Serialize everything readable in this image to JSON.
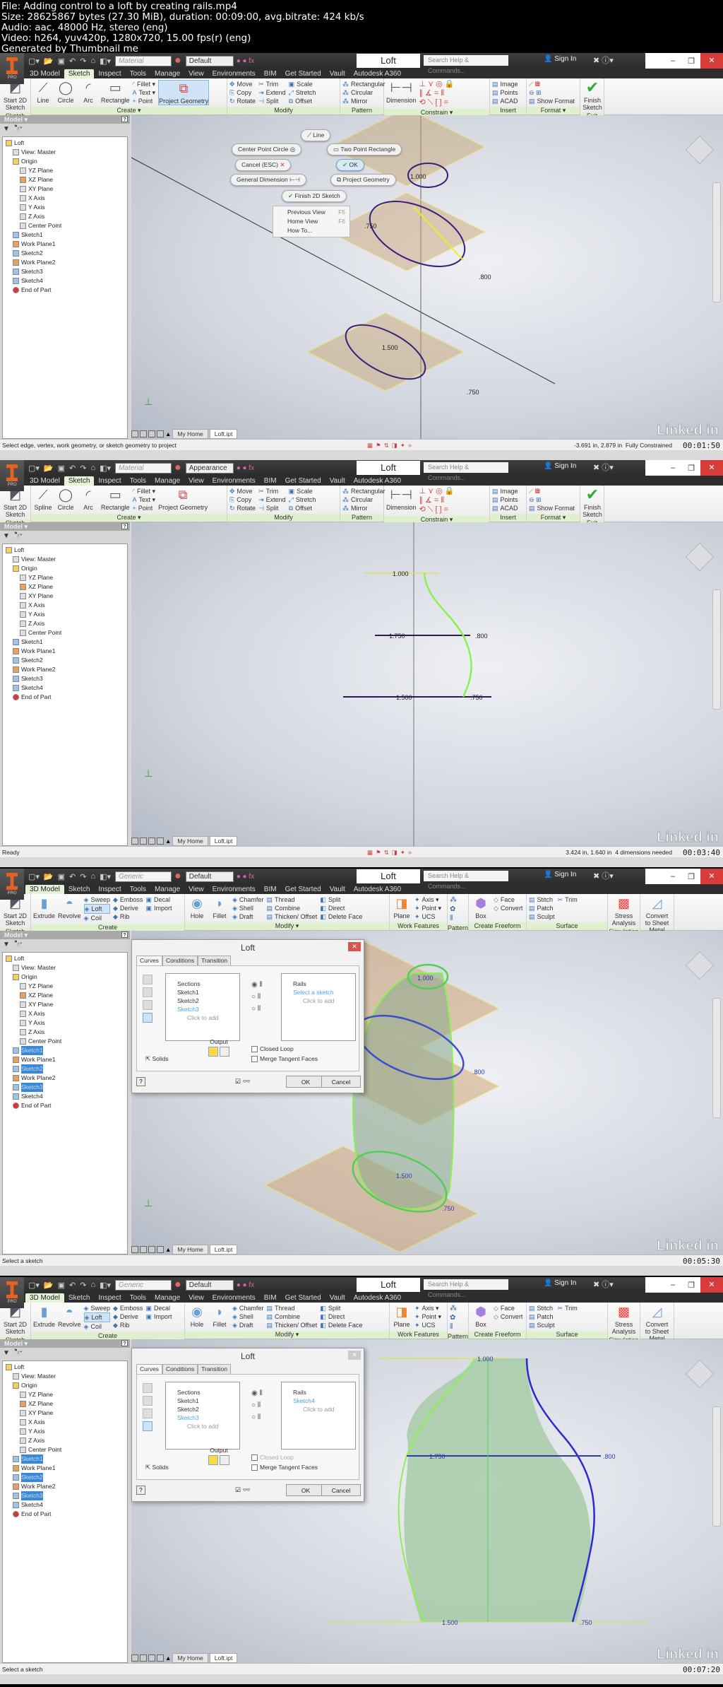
{
  "header": {
    "file": "File: Adding control to a loft by creating rails.mp4",
    "size": "Size: 28625867 bytes (27.30 MiB), duration: 00:09:00, avg.bitrate: 424 kb/s",
    "audio": "Audio: aac, 48000 Hz, stereo (eng)",
    "video": "Video: h264, yuv420p, 1280x720, 15.00 fps(r) (eng)",
    "generator": "Generated by Thumbnail me"
  },
  "common": {
    "doc_title": "Loft",
    "search_placeholder": "Search Help & Commands...",
    "sign_in": "Sign In",
    "tabs": [
      "3D Model",
      "Sketch",
      "Inspect",
      "Tools",
      "Manage",
      "View",
      "Environments",
      "BIM",
      "Get Started",
      "Vault",
      "Autodesk A360"
    ],
    "browser_title": "Model ▾",
    "doc_tabs": {
      "home": "My Home",
      "file": "Loft.ipt"
    },
    "watermark": "Linked in",
    "win": {
      "min": "–",
      "restore": "❐",
      "close": "✕"
    }
  },
  "sketch_ribbon": {
    "sketch_panel": {
      "label": "Sketch",
      "start": "Start 2D Sketch"
    },
    "create_panel": {
      "label": "Create ▾",
      "circle": "Circle",
      "arc": "Arc",
      "rectangle": "Rectangle",
      "fillet": "Fillet ▾",
      "text": "Text ▾",
      "point": "Point",
      "project": "Project Geometry"
    },
    "modify_panel": {
      "label": "Modify",
      "items": [
        "Move",
        "Trim",
        "Scale",
        "Copy",
        "Extend",
        "Stretch",
        "Rotate",
        "Split",
        "Offset"
      ]
    },
    "pattern_panel": {
      "label": "Pattern",
      "items": [
        "Rectangular",
        "Circular",
        "Mirror"
      ]
    },
    "constrain_panel": {
      "label": "Constrain ▾",
      "dimension": "Dimension"
    },
    "insert_panel": {
      "label": "Insert",
      "items": [
        "Image",
        "Points",
        "ACAD"
      ]
    },
    "format_panel": {
      "label": "Format ▾",
      "show_format": "Show Format"
    },
    "exit_panel": {
      "label": "Exit",
      "finish": "Finish Sketch"
    }
  },
  "model_ribbon": {
    "sketch_panel": {
      "label": "Sketch",
      "start": "Start 2D Sketch"
    },
    "create_panel": {
      "label": "Create",
      "extrude": "Extrude",
      "revolve": "Revolve",
      "col1": [
        "Sweep",
        "Loft",
        "Coil"
      ],
      "col2": [
        "Emboss",
        "Derive",
        "Rib"
      ],
      "col3": [
        "Decal",
        "Import"
      ]
    },
    "modify_panel": {
      "label": "Modify ▾",
      "hole": "Hole",
      "fillet": "Fillet",
      "col1": [
        "Chamfer",
        "Shell",
        "Draft"
      ],
      "col2": [
        "Thread",
        "Combine",
        "Thicken/ Offset"
      ],
      "col3": [
        "Split",
        "Direct",
        "Delete Face"
      ]
    },
    "work_panel": {
      "label": "Work Features",
      "plane": "Plane",
      "items": [
        "Axis ▾",
        "Point ▾",
        "UCS"
      ]
    },
    "pattern_panel": {
      "label": "Pattern"
    },
    "freeform_panel": {
      "label": "Create Freeform",
      "box": "Box",
      "items": [
        "Face",
        "Convert"
      ]
    },
    "surface_panel": {
      "label": "Surface",
      "items": [
        "Stitch",
        "Patch",
        "Sculpt",
        "Trim"
      ]
    },
    "simulation_panel": {
      "label": "Simulation",
      "stress": "Stress Analysis"
    },
    "convert_panel": {
      "label": "Convert",
      "sheet": "Convert to Sheet Metal"
    }
  },
  "tree": {
    "items": [
      {
        "label": "Loft",
        "indent": 0,
        "icon": "part"
      },
      {
        "label": "View: Master",
        "indent": 1,
        "icon": "view"
      },
      {
        "label": "Origin",
        "indent": 1,
        "icon": "folder"
      },
      {
        "label": "YZ Plane",
        "indent": 2,
        "icon": "plane"
      },
      {
        "label": "XZ Plane",
        "indent": 2,
        "icon": "plane-active"
      },
      {
        "label": "XY Plane",
        "indent": 2,
        "icon": "plane"
      },
      {
        "label": "X Axis",
        "indent": 2,
        "icon": "axis"
      },
      {
        "label": "Y Axis",
        "indent": 2,
        "icon": "axis"
      },
      {
        "label": "Z Axis",
        "indent": 2,
        "icon": "axis"
      },
      {
        "label": "Center Point",
        "indent": 2,
        "icon": "point"
      },
      {
        "label": "Sketch1",
        "indent": 1,
        "icon": "sketch"
      },
      {
        "label": "Work Plane1",
        "indent": 1,
        "icon": "workplane"
      },
      {
        "label": "Sketch2",
        "indent": 1,
        "icon": "sketch"
      },
      {
        "label": "Work Plane2",
        "indent": 1,
        "icon": "workplane"
      },
      {
        "label": "Sketch3",
        "indent": 1,
        "icon": "sketch"
      },
      {
        "label": "Sketch4",
        "indent": 1,
        "icon": "sketch"
      },
      {
        "label": "End of Part",
        "indent": 1,
        "icon": "end"
      }
    ]
  },
  "frames": [
    {
      "material": "Material",
      "appearance": "Default",
      "active_tab": "Sketch",
      "ribbon": "sketch",
      "line_tool": "Line",
      "project_highlight": true,
      "status": "Select edge, vertex, work geometry,  or sketch geometry to project",
      "coords": "-3.691 in, 2.879 in",
      "constraint": "Fully Constrained",
      "timestamp": "00:01:50",
      "marking_menu": {
        "line": "Line",
        "circle": "Center Point Circle",
        "rect": "Two Point Rectangle",
        "cancel": "Cancel (ESC)",
        "ok": "OK",
        "dim": "General Dimension",
        "project": "Project Geometry",
        "finish": "Finish 2D Sketch"
      },
      "context_menu": [
        {
          "label": "Previous View",
          "key": "F5"
        },
        {
          "label": "Home View",
          "key": "F6"
        },
        {
          "label": "How To...",
          "key": ""
        }
      ],
      "dims": [
        "1.000",
        ".750",
        ".800",
        "1.500",
        ".750"
      ]
    },
    {
      "material": "Material",
      "appearance": "Appearance",
      "active_tab": "Sketch",
      "ribbon": "sketch",
      "line_tool": "Spline",
      "project_highlight": false,
      "status": "Ready",
      "coords": "3.424 in, 1.640 in",
      "constraint": "4 dimensions needed",
      "timestamp": "00:03:40",
      "dims": [
        "1.000",
        "1.750",
        ".800",
        "1.500",
        ".750"
      ]
    },
    {
      "material": "Generic",
      "appearance": "Default",
      "active_tab": "3D Model",
      "ribbon": "model",
      "status": "Select a sketch",
      "timestamp": "00:05:30",
      "selected_sketches": [
        "Sketch1",
        "Sketch2",
        "Sketch3"
      ],
      "dialog": {
        "title": "Loft",
        "tabs": [
          "Curves",
          "Conditions",
          "Transition"
        ],
        "sections_header": "Sections",
        "sections": [
          "Sketch1",
          "Sketch2",
          "Sketch3"
        ],
        "sections_add": "Click to add",
        "rails_header": "Rails",
        "rails": [
          "Select a sketch"
        ],
        "rails_add": "Click to add",
        "output": "Output",
        "closed_loop": "Closed Loop",
        "merge": "Merge Tangent Faces",
        "solids": "Solids",
        "ok": "OK",
        "cancel": "Cancel",
        "closed_loop_disabled": false,
        "close_active": true
      },
      "dims": [
        "1.000",
        ".800",
        "1.500",
        ".750"
      ]
    },
    {
      "material": "Generic",
      "appearance": "Default",
      "active_tab": "3D Model",
      "ribbon": "model",
      "status": "Select a sketch",
      "timestamp": "00:07:20",
      "selected_sketches": [
        "Sketch1",
        "Sketch2",
        "Sketch3"
      ],
      "dialog": {
        "title": "Loft",
        "tabs": [
          "Curves",
          "Conditions",
          "Transition"
        ],
        "sections_header": "Sections",
        "sections": [
          "Sketch1",
          "Sketch2",
          "Sketch3"
        ],
        "sections_add": "Click to add",
        "rails_header": "Rails",
        "rails": [
          "Sketch4"
        ],
        "rails_add": "Click to add",
        "output": "Output",
        "closed_loop": "Closed Loop",
        "merge": "Merge Tangent Faces",
        "solids": "Solids",
        "ok": "OK",
        "cancel": "Cancel",
        "closed_loop_disabled": true,
        "close_active": false
      },
      "dims": [
        "1.000",
        "1.750",
        ".800",
        "1.500",
        ".750"
      ]
    }
  ]
}
